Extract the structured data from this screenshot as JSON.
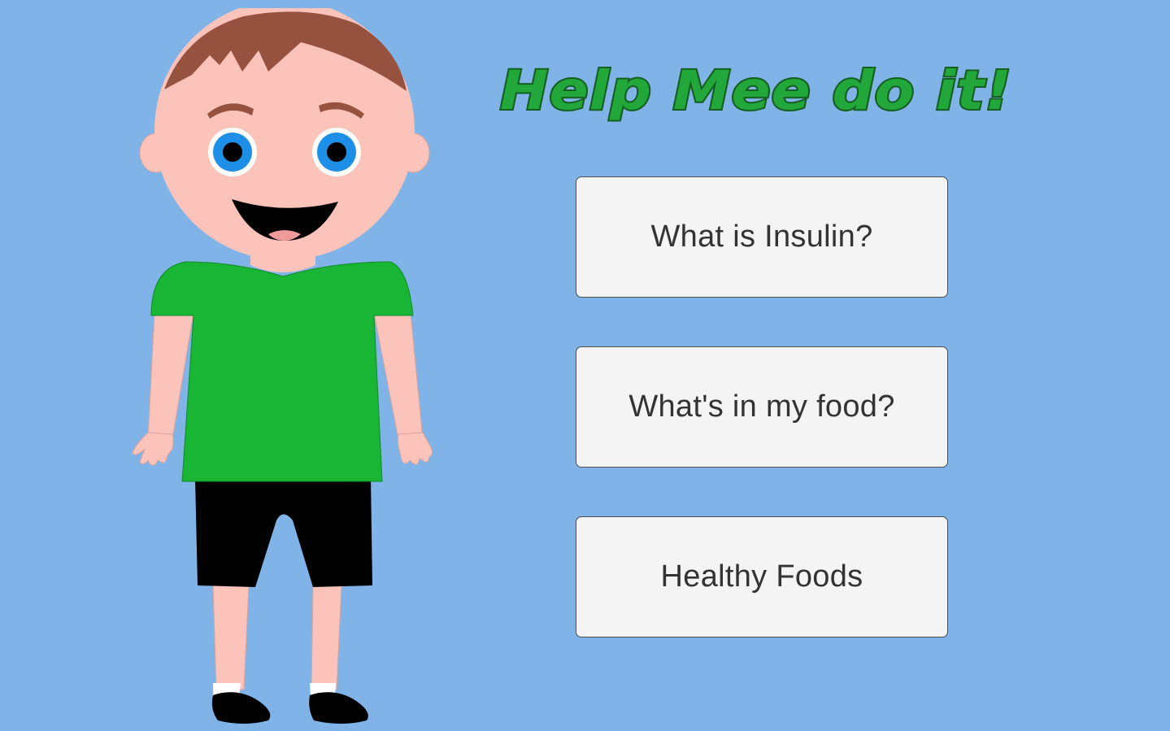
{
  "app": {
    "title": "Help Mee do it!",
    "background_color": "#80b3e7",
    "title_color": "#22a83a",
    "title_outline_color": "#155f20"
  },
  "menu": {
    "buttons": [
      {
        "label": "What is Insulin?"
      },
      {
        "label": "What's in my food?"
      },
      {
        "label": "Healthy Foods"
      }
    ]
  },
  "character": {
    "name": "boy-character",
    "shirt_color": "#19b534",
    "shorts_color": "#000000",
    "skin_color": "#fcc3bb",
    "hair_color": "#96513f",
    "eye_color": "#1e8fe6"
  }
}
